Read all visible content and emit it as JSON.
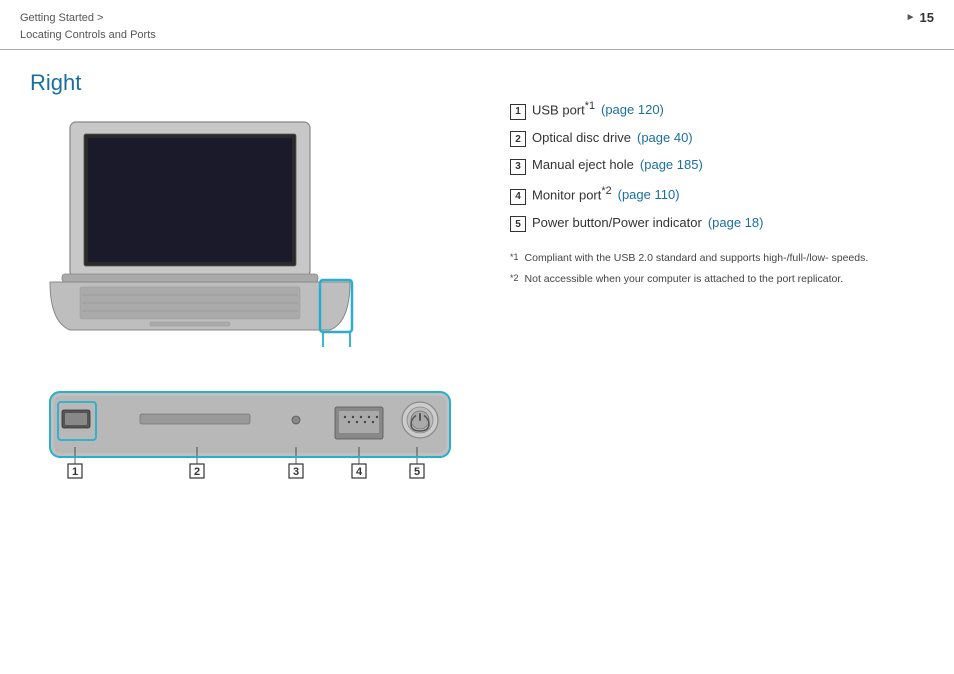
{
  "header": {
    "breadcrumb_line1": "Getting Started >",
    "breadcrumb_line2": "Locating Controls and Ports",
    "page_number": "15"
  },
  "section": {
    "title": "Right"
  },
  "items": [
    {
      "number": "1",
      "text": "USB port",
      "superscript": "*1",
      "link_text": "(page 120)"
    },
    {
      "number": "2",
      "text": "Optical disc drive",
      "superscript": "",
      "link_text": "(page 40)"
    },
    {
      "number": "3",
      "text": "Manual eject hole",
      "superscript": "",
      "link_text": "(page 185)"
    },
    {
      "number": "4",
      "text": "Monitor port",
      "superscript": "*2",
      "link_text": "(page 110)"
    },
    {
      "number": "5",
      "text": "Power button/Power indicator",
      "superscript": "",
      "link_text": "(page 18)"
    }
  ],
  "footnotes": [
    {
      "mark": "*1",
      "text": "Compliant with the USB 2.0 standard and supports high-/full-/low- speeds."
    },
    {
      "mark": "*2",
      "text": "Not accessible when your computer is attached to the port replicator."
    }
  ]
}
